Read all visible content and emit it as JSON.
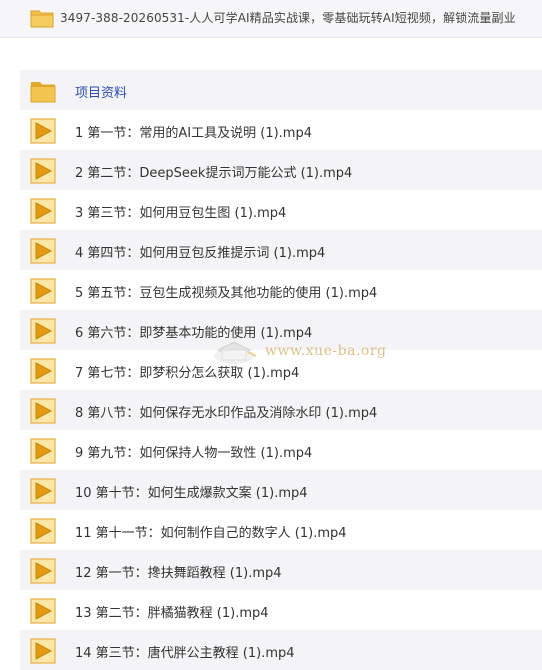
{
  "header": {
    "title": "3497-388-20260531-人人可学AI精品实战课，零基础玩转AI短视频，解锁流量副业",
    "icon": "folder-icon"
  },
  "colors": {
    "folder_yellow": "#f2c14e",
    "folder_dark": "#e0a92a",
    "video_orange": "#e6a21c",
    "folder_label": "#2b4bb0"
  },
  "items": [
    {
      "type": "folder",
      "icon": "folder-icon",
      "label": "项目资料"
    },
    {
      "type": "video",
      "icon": "video-file-icon",
      "label": "1 第一节：常用的AI工具及说明 (1).mp4"
    },
    {
      "type": "video",
      "icon": "video-file-icon",
      "label": "2 第二节：DeepSeek提示词万能公式 (1).mp4"
    },
    {
      "type": "video",
      "icon": "video-file-icon",
      "label": "3 第三节：如何用豆包生图 (1).mp4"
    },
    {
      "type": "video",
      "icon": "video-file-icon",
      "label": "4 第四节：如何用豆包反推提示词 (1).mp4"
    },
    {
      "type": "video",
      "icon": "video-file-icon",
      "label": "5 第五节：豆包生成视频及其他功能的使用 (1).mp4"
    },
    {
      "type": "video",
      "icon": "video-file-icon",
      "label": "6 第六节：即梦基本功能的使用 (1).mp4"
    },
    {
      "type": "video",
      "icon": "video-file-icon",
      "label": "7 第七节：即梦积分怎么获取 (1).mp4"
    },
    {
      "type": "video",
      "icon": "video-file-icon",
      "label": "8 第八节：如何保存无水印作品及消除水印 (1).mp4"
    },
    {
      "type": "video",
      "icon": "video-file-icon",
      "label": "9 第九节：如何保持人物一致性 (1).mp4"
    },
    {
      "type": "video",
      "icon": "video-file-icon",
      "label": "10 第十节：如何生成爆款文案 (1).mp4"
    },
    {
      "type": "video",
      "icon": "video-file-icon",
      "label": "11 第十一节：如何制作自己的数字人 (1).mp4"
    },
    {
      "type": "video",
      "icon": "video-file-icon",
      "label": "12 第一节：搀扶舞蹈教程 (1).mp4"
    },
    {
      "type": "video",
      "icon": "video-file-icon",
      "label": "13 第二节：胖橘猫教程 (1).mp4"
    },
    {
      "type": "video",
      "icon": "video-file-icon",
      "label": "14 第三节：唐代胖公主教程 (1).mp4"
    }
  ],
  "watermark": {
    "text": "www.xue-ba.org",
    "icon": "watermark-logo-icon"
  }
}
